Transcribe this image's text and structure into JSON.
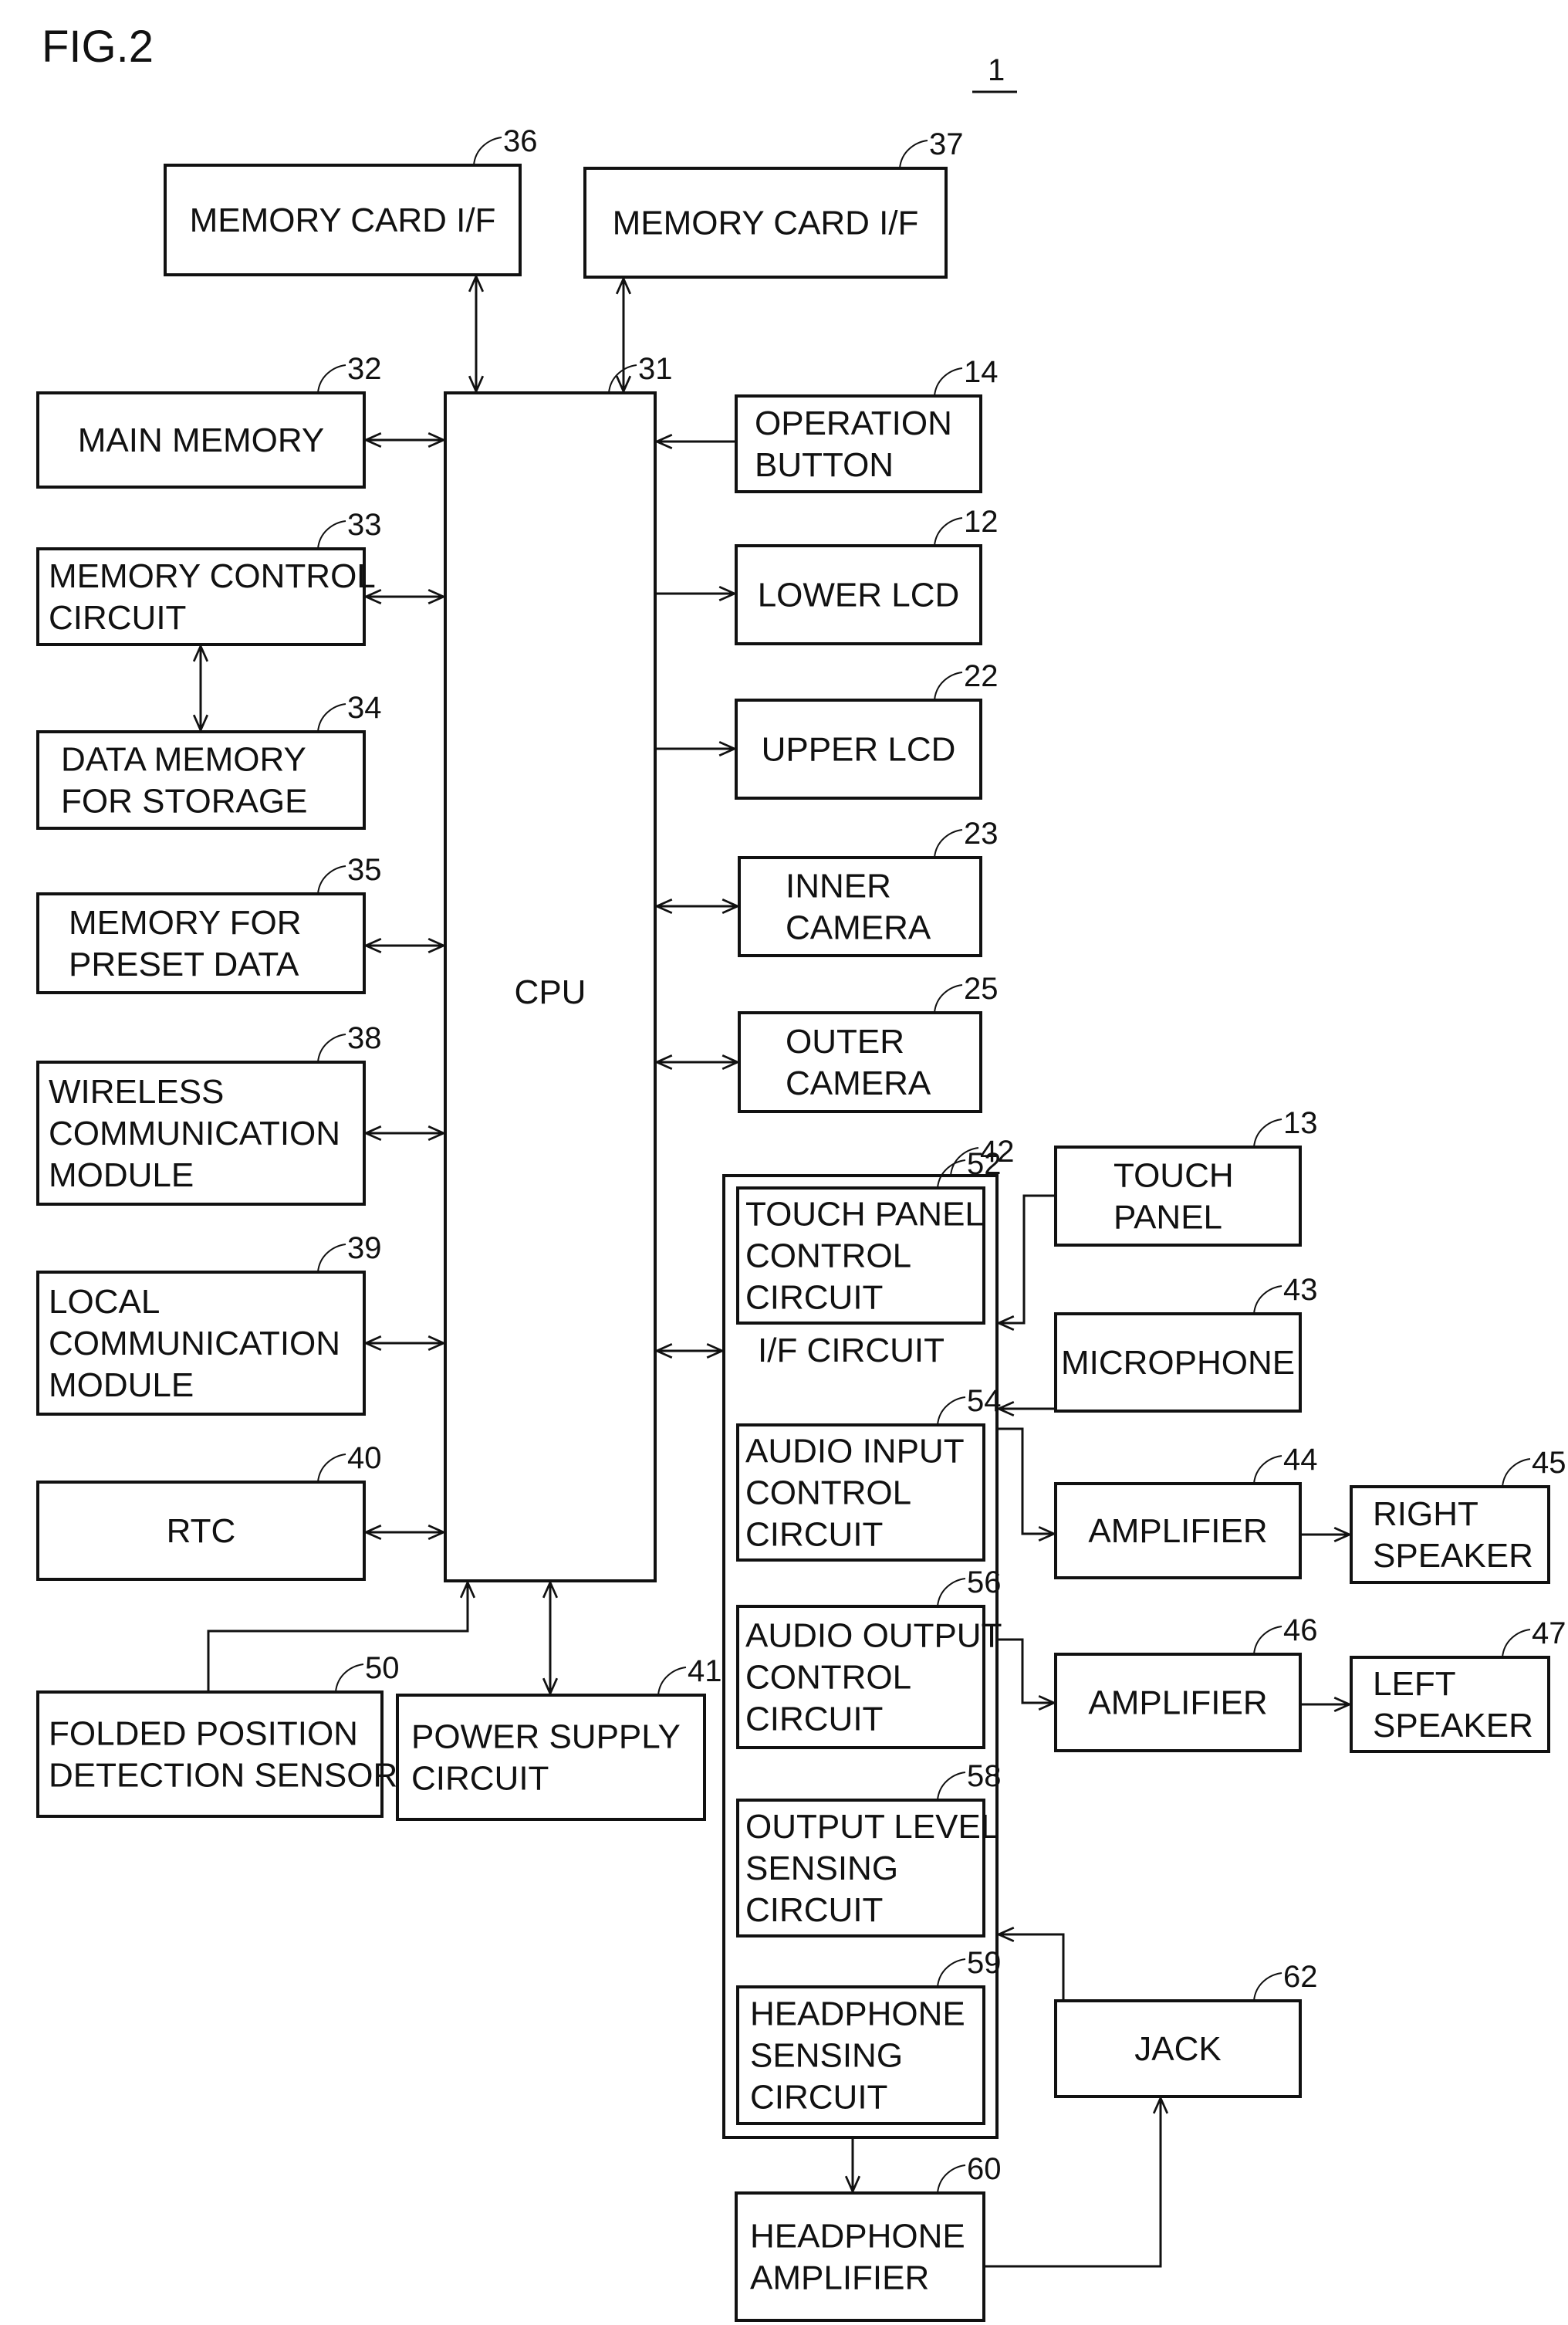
{
  "figure": {
    "title": "FIG.2",
    "ref": "1"
  },
  "blocks": {
    "mem_card_36": {
      "ref": "36",
      "lines": [
        "MEMORY CARD I/F"
      ]
    },
    "mem_card_37": {
      "ref": "37",
      "lines": [
        "MEMORY CARD I/F"
      ]
    },
    "cpu": {
      "ref": "31",
      "lines": [
        "CPU"
      ]
    },
    "main_memory": {
      "ref": "32",
      "lines": [
        "MAIN MEMORY"
      ]
    },
    "memory_control": {
      "ref": "33",
      "lines": [
        "MEMORY CONTROL",
        "CIRCUIT"
      ]
    },
    "data_memory": {
      "ref": "34",
      "lines": [
        "DATA MEMORY",
        "FOR STORAGE"
      ]
    },
    "preset_memory": {
      "ref": "35",
      "lines": [
        "MEMORY FOR",
        "PRESET DATA"
      ]
    },
    "wireless": {
      "ref": "38",
      "lines": [
        "WIRELESS",
        "COMMUNICATION",
        "MODULE"
      ]
    },
    "local": {
      "ref": "39",
      "lines": [
        "LOCAL",
        "COMMUNICATION",
        "MODULE"
      ]
    },
    "rtc": {
      "ref": "40",
      "lines": [
        "RTC"
      ]
    },
    "folded": {
      "ref": "50",
      "lines": [
        "FOLDED POSITION",
        "DETECTION SENSOR"
      ]
    },
    "power": {
      "ref": "41",
      "lines": [
        "POWER SUPPLY",
        "CIRCUIT"
      ]
    },
    "op_button": {
      "ref": "14",
      "lines": [
        "OPERATION",
        "BUTTON"
      ]
    },
    "lower_lcd": {
      "ref": "12",
      "lines": [
        "LOWER LCD"
      ]
    },
    "upper_lcd": {
      "ref": "22",
      "lines": [
        "UPPER LCD"
      ]
    },
    "inner_camera": {
      "ref": "23",
      "lines": [
        "INNER",
        "CAMERA"
      ]
    },
    "outer_camera": {
      "ref": "25",
      "lines": [
        "OUTER",
        "CAMERA"
      ]
    },
    "if_circuit": {
      "ref": "42",
      "lines": [
        "I/F CIRCUIT"
      ]
    },
    "touch_ctrl": {
      "ref": "52",
      "lines": [
        "TOUCH PANEL",
        "CONTROL",
        "CIRCUIT"
      ]
    },
    "audio_in": {
      "ref": "54",
      "lines": [
        "AUDIO INPUT",
        "CONTROL",
        "CIRCUIT"
      ]
    },
    "audio_out": {
      "ref": "56",
      "lines": [
        "AUDIO OUTPUT",
        "CONTROL",
        "CIRCUIT"
      ]
    },
    "output_level": {
      "ref": "58",
      "lines": [
        "OUTPUT LEVEL",
        "SENSING",
        "CIRCUIT"
      ]
    },
    "hp_sensing": {
      "ref": "59",
      "lines": [
        "HEADPHONE",
        "SENSING",
        "CIRCUIT"
      ]
    },
    "touch_panel": {
      "ref": "13",
      "lines": [
        "TOUCH",
        "PANEL"
      ]
    },
    "microphone": {
      "ref": "43",
      "lines": [
        "MICROPHONE"
      ]
    },
    "amp_right": {
      "ref": "44",
      "lines": [
        "AMPLIFIER"
      ]
    },
    "right_speaker": {
      "ref": "45",
      "lines": [
        "RIGHT",
        "SPEAKER"
      ]
    },
    "amp_left": {
      "ref": "46",
      "lines": [
        "AMPLIFIER"
      ]
    },
    "left_speaker": {
      "ref": "47",
      "lines": [
        "LEFT",
        "SPEAKER"
      ]
    },
    "jack": {
      "ref": "62",
      "lines": [
        "JACK"
      ]
    },
    "hp_amp": {
      "ref": "60",
      "lines": [
        "HEADPHONE",
        "AMPLIFIER"
      ]
    }
  }
}
